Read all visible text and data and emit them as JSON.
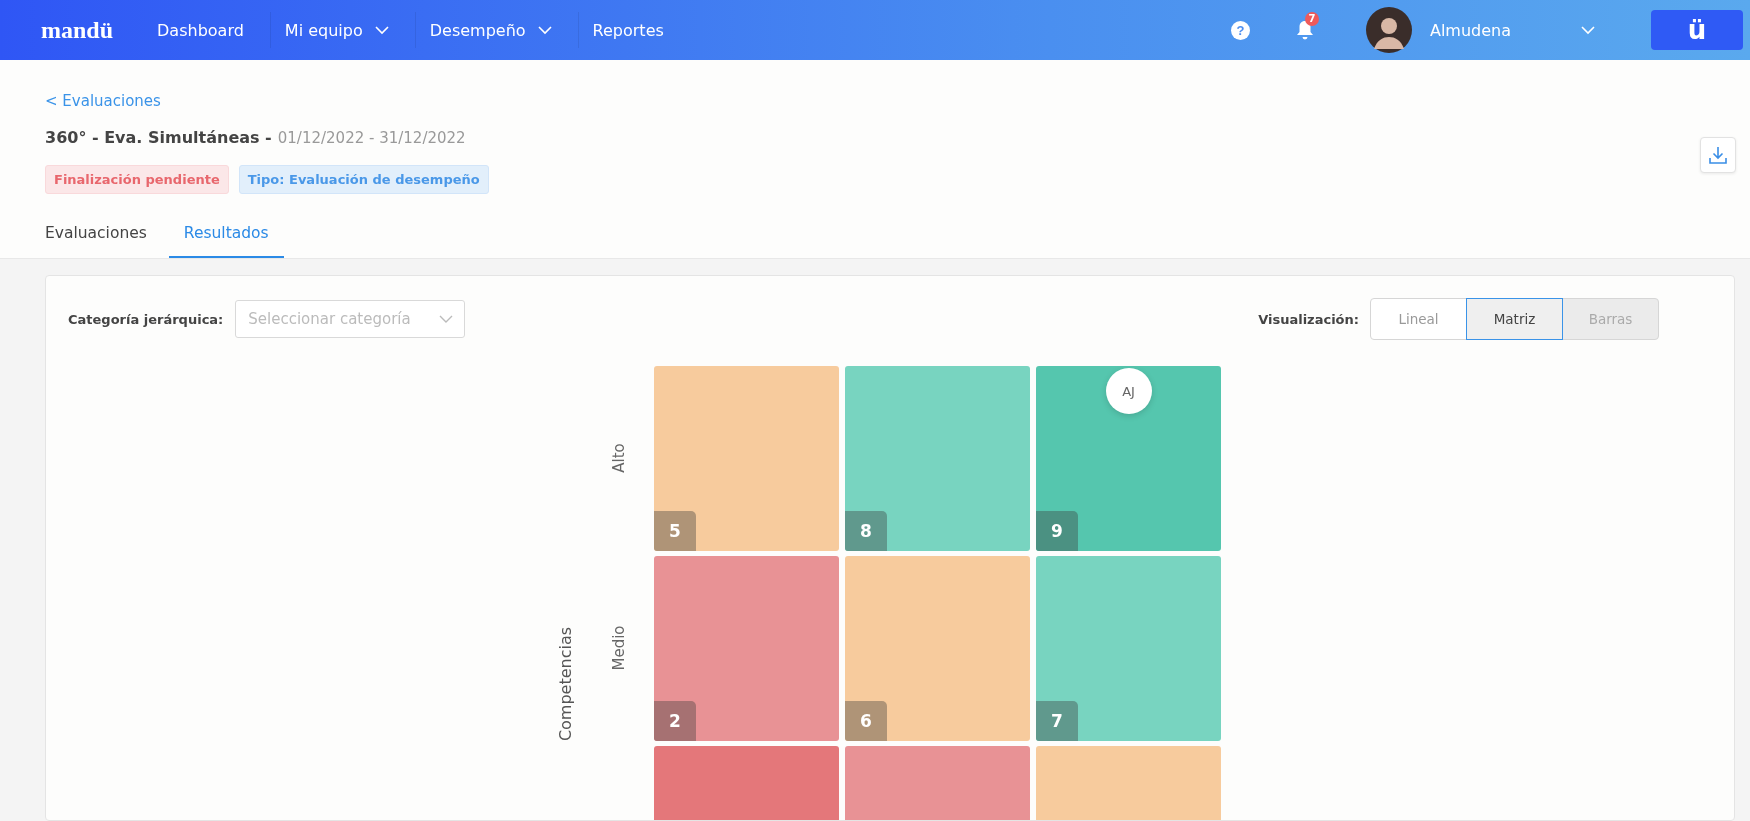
{
  "nav": {
    "logo": "mandü",
    "items": [
      {
        "label": "Dashboard",
        "dropdown": false
      },
      {
        "label": "Mi equipo",
        "dropdown": true
      },
      {
        "label": "Desempeño",
        "dropdown": true
      },
      {
        "label": "Reportes",
        "dropdown": false
      }
    ],
    "help": "?",
    "notifications": "7",
    "user": "Almudena",
    "app_button": "ü"
  },
  "breadcrumb": "< Evaluaciones",
  "title": "360° - Eva. Simultáneas -",
  "dates": "01/12/2022 - 31/12/2022",
  "tags": [
    {
      "label": "Finalización pendiente",
      "color": "#e8676d"
    },
    {
      "label": "Tipo: Evaluación de desempeño",
      "color": "#4a98e8"
    }
  ],
  "tabs": [
    {
      "label": "Evaluaciones",
      "selected": false
    },
    {
      "label": "Resultados",
      "selected": true
    }
  ],
  "filter": {
    "label": "Categoría jerárquica:",
    "placeholder": "Seleccionar categoría"
  },
  "visualization": {
    "label": "Visualización:",
    "options": [
      {
        "label": "Lineal",
        "selected": false,
        "hovered": false
      },
      {
        "label": "Matriz",
        "selected": true,
        "hovered": false
      },
      {
        "label": "Barras",
        "selected": false,
        "hovered": true
      }
    ]
  },
  "matrix": {
    "y_title": "Competencias",
    "rows": [
      {
        "label": "Alto",
        "cells": [
          {
            "number": "5",
            "color": "#f7cb9d"
          },
          {
            "number": "8",
            "color": "#78d4c0"
          },
          {
            "number": "9",
            "color": "#55c6ae",
            "avatars": [
              "AJ"
            ]
          }
        ]
      },
      {
        "label": "Medio",
        "cells": [
          {
            "number": "2",
            "color": "#e89295"
          },
          {
            "number": "6",
            "color": "#f7cb9d"
          },
          {
            "number": "7",
            "color": "#78d4c0"
          }
        ]
      },
      {
        "cells": [
          {
            "color": "#e4777a"
          },
          {
            "color": "#e89295"
          },
          {
            "color": "#f7cb9d"
          }
        ]
      }
    ]
  }
}
